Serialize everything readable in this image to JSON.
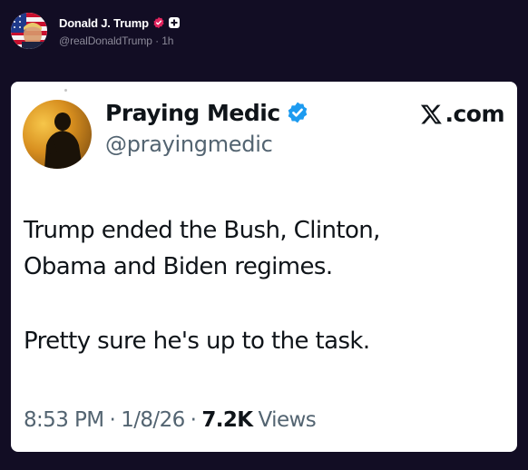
{
  "post": {
    "author": {
      "display_name": "Donald J. Trump",
      "handle": "@realDonaldTrump",
      "time_ago": "1h",
      "separator": "·",
      "avatar_icon": "flag-portrait-avatar",
      "verified_badge_color": "#e0245e"
    }
  },
  "embedded_tweet": {
    "author": {
      "display_name": "Praying Medic",
      "handle": "@prayingmedic",
      "verified_badge_color": "#1d9bf0",
      "avatar_icon": "sunset-silhouette-avatar"
    },
    "source": "X.com",
    "text_lines": [
      "Trump ended the Bush, Clinton,",
      "Obama and Biden regimes.",
      "Pretty sure he's up to the task."
    ],
    "meta": {
      "time": "8:53 PM",
      "date": "1/8/26",
      "separator": "·",
      "views_count": "7.2K",
      "views_label": "Views"
    }
  },
  "colors": {
    "background": "#120d24",
    "card": "#ffffff",
    "primary_text": "#0f1419",
    "secondary_text": "#536471"
  }
}
